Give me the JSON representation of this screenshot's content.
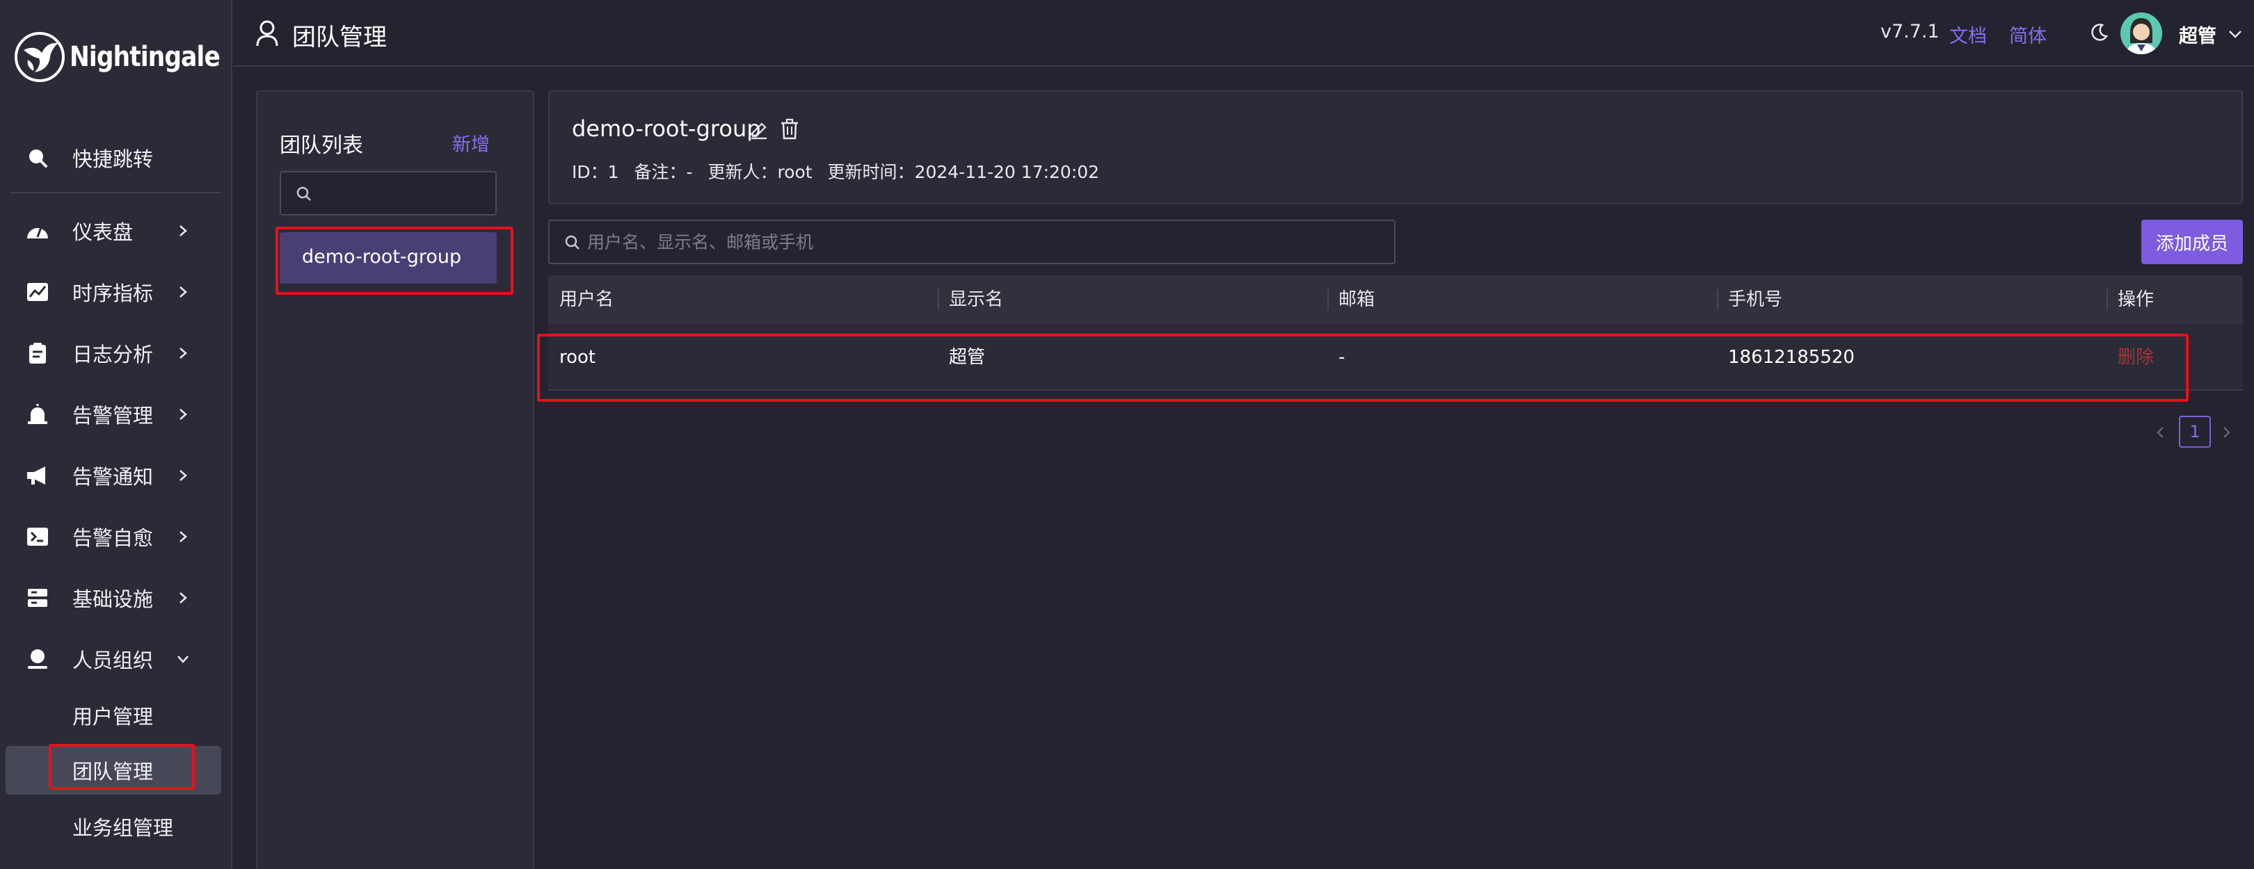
{
  "app": {
    "logo_text": "Nightingale"
  },
  "sidebar": {
    "items": [
      {
        "label": "快捷跳转",
        "icon": "search-icon"
      },
      {
        "label": "仪表盘",
        "icon": "dashboard-icon"
      },
      {
        "label": "时序指标",
        "icon": "line-chart-icon"
      },
      {
        "label": "日志分析",
        "icon": "log-icon"
      },
      {
        "label": "告警管理",
        "icon": "alarm-icon"
      },
      {
        "label": "告警通知",
        "icon": "megaphone-icon"
      },
      {
        "label": "告警自愈",
        "icon": "terminal-icon"
      },
      {
        "label": "基础设施",
        "icon": "server-icon"
      },
      {
        "label": "人员组织",
        "icon": "user-icon"
      }
    ],
    "sub_items": [
      {
        "label": "用户管理"
      },
      {
        "label": "团队管理",
        "active": true
      },
      {
        "label": "业务组管理"
      }
    ]
  },
  "header": {
    "title": "团队管理",
    "version": "v7.7.1",
    "docs": "文档",
    "language": "简体",
    "username": "超管"
  },
  "team_list": {
    "title": "团队列表",
    "add_label": "新增",
    "search_value": "",
    "teams": [
      {
        "name": "demo-root-group",
        "selected": true
      }
    ]
  },
  "group": {
    "name": "demo-root-group",
    "id": "ID：1",
    "note": "备注：-",
    "updater": "更新人：root",
    "updated": "更新时间：2024-11-20 17:20:02"
  },
  "members": {
    "search_placeholder": "用户名、显示名、邮箱或手机",
    "add_button": "添加成员",
    "columns": [
      "用户名",
      "显示名",
      "邮箱",
      "手机号",
      "操作"
    ],
    "rows": [
      {
        "username": "root",
        "display_name": "超管",
        "email": "-",
        "phone": "18612185520",
        "action": "删除"
      }
    ],
    "pagination": {
      "current_page": "1"
    }
  },
  "colors": {
    "accent": "#7d5ce0",
    "highlight": "#e8101c",
    "danger": "#a8323a"
  }
}
